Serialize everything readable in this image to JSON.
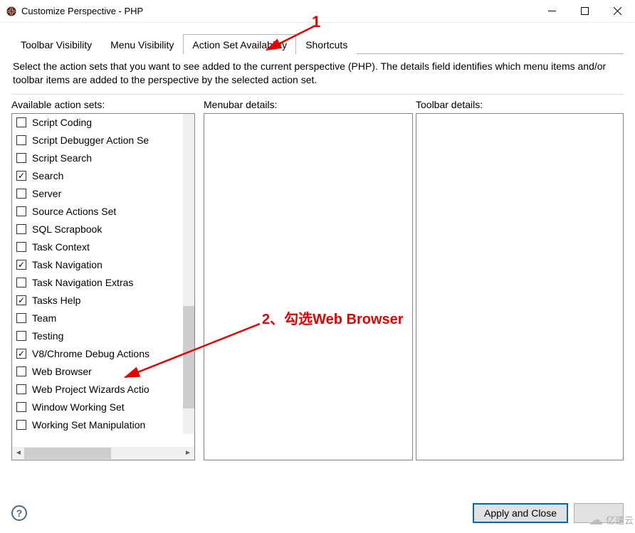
{
  "window": {
    "title": "Customize Perspective - PHP"
  },
  "tabs": {
    "toolbar": "Toolbar Visibility",
    "menu": "Menu Visibility",
    "actionset": "Action Set Availability",
    "shortcuts": "Shortcuts"
  },
  "description": "Select the action sets that you want to see added to the current perspective (PHP).  The details field identifies which menu items and/or toolbar items are added to the perspective by the selected action set.",
  "columns": {
    "available": "Available action sets:",
    "menubar": "Menubar details:",
    "toolbar": "Toolbar details:"
  },
  "actionSets": [
    {
      "label": "Script Coding",
      "checked": false
    },
    {
      "label": "Script Debugger Action Se",
      "checked": false
    },
    {
      "label": "Script Search",
      "checked": false
    },
    {
      "label": "Search",
      "checked": true
    },
    {
      "label": "Server",
      "checked": false
    },
    {
      "label": "Source Actions Set",
      "checked": false
    },
    {
      "label": "SQL Scrapbook",
      "checked": false
    },
    {
      "label": "Task Context",
      "checked": false
    },
    {
      "label": "Task Navigation",
      "checked": true
    },
    {
      "label": "Task Navigation Extras",
      "checked": false
    },
    {
      "label": "Tasks Help",
      "checked": true
    },
    {
      "label": "Team",
      "checked": false
    },
    {
      "label": "Testing",
      "checked": false
    },
    {
      "label": "V8/Chrome Debug Actions",
      "checked": true
    },
    {
      "label": "Web Browser",
      "checked": false
    },
    {
      "label": "Web Project Wizards Actio",
      "checked": false
    },
    {
      "label": "Window Working Set",
      "checked": false
    },
    {
      "label": "Working Set Manipulation",
      "checked": false
    }
  ],
  "buttons": {
    "apply": "Apply and Close",
    "cancel": ""
  },
  "annotations": {
    "a1": "1",
    "a2": "2、勾选Web Browser"
  },
  "watermark": "亿速云"
}
